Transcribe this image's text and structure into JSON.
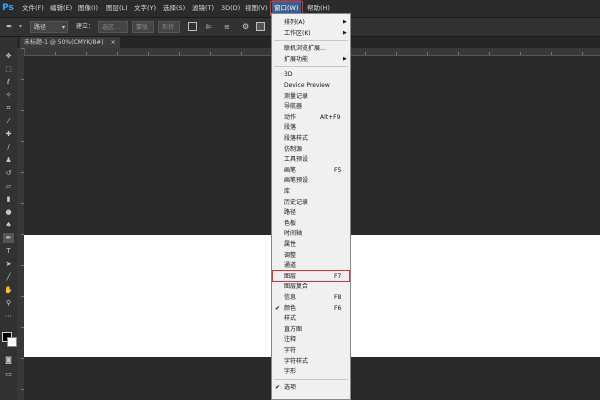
{
  "menubar": {
    "logo": "Ps",
    "items": [
      "文件(F)",
      "编辑(E)",
      "图像(I)",
      "图层(L)",
      "文字(Y)",
      "选择(S)",
      "滤镜(T)",
      "3D(D)",
      "视图(V)",
      "窗口(W)",
      "帮助(H)"
    ]
  },
  "options": {
    "path_mode": "路径",
    "build_label": "建立：",
    "selection_btn": "选区...",
    "mask_btn": "蒙版",
    "shape_btn": "形状"
  },
  "tab": {
    "title": "未标题-1 @ 50%(CMYK/8#)",
    "close": "×"
  },
  "window_menu": {
    "items": [
      {
        "label": "排列(A)",
        "submenu": true
      },
      {
        "label": "工作区(K)",
        "submenu": true
      },
      {
        "sep": true
      },
      {
        "label": "联机浏览扩展..."
      },
      {
        "label": "扩展功能",
        "submenu": true
      },
      {
        "sep": true
      },
      {
        "label": "3D"
      },
      {
        "label": "Device Preview"
      },
      {
        "label": "测量记录"
      },
      {
        "label": "导航器"
      },
      {
        "label": "动作",
        "shortcut": "Alt+F9"
      },
      {
        "label": "段落"
      },
      {
        "label": "段落样式"
      },
      {
        "label": "仿制源"
      },
      {
        "label": "工具预设"
      },
      {
        "label": "画笔",
        "shortcut": "F5"
      },
      {
        "label": "画笔预设"
      },
      {
        "label": "库"
      },
      {
        "label": "历史记录"
      },
      {
        "label": "路径"
      },
      {
        "label": "色板"
      },
      {
        "label": "时间轴"
      },
      {
        "label": "属性"
      },
      {
        "label": "调整"
      },
      {
        "label": "通道"
      },
      {
        "label": "图层",
        "shortcut": "F7",
        "highlighted": true
      },
      {
        "label": "图层复合"
      },
      {
        "label": "信息",
        "shortcut": "F8"
      },
      {
        "label": "颜色",
        "shortcut": "F6",
        "checked": true
      },
      {
        "label": "样式"
      },
      {
        "label": "直方图"
      },
      {
        "label": "注释"
      },
      {
        "label": "字符"
      },
      {
        "label": "字符样式"
      },
      {
        "label": "字形"
      },
      {
        "sep": true
      },
      {
        "label": "选项",
        "checked": true
      }
    ]
  },
  "colors": {
    "highlight": "#e03030",
    "menu_bg": "#f0f0f0",
    "app_bg": "#282828",
    "accent": "#31a8ff"
  }
}
